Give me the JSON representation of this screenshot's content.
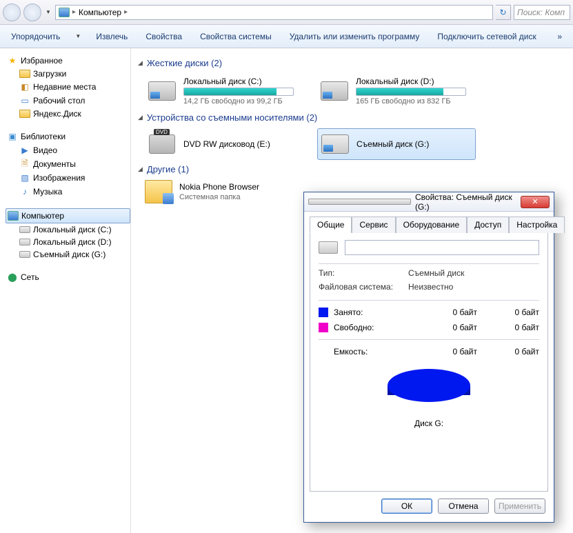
{
  "address": {
    "root": "Компьютер"
  },
  "search": {
    "placeholder": "Поиск: Комп"
  },
  "toolbar": {
    "organize": "Упорядочить",
    "eject": "Извлечь",
    "properties": "Свойства",
    "system_properties": "Свойства системы",
    "uninstall": "Удалить или изменить программу",
    "map_drive": "Подключить сетевой диск",
    "overflow": "»"
  },
  "sidebar": {
    "favorites": "Избранное",
    "fav_items": [
      "Загрузки",
      "Недавние места",
      "Рабочий стол",
      "Яндекс.Диск"
    ],
    "libraries": "Библиотеки",
    "lib_items": [
      "Видео",
      "Документы",
      "Изображения",
      "Музыка"
    ],
    "computer": "Компьютер",
    "comp_items": [
      "Локальный диск (C:)",
      "Локальный диск (D:)",
      "Съемный диск (G:)"
    ],
    "network": "Сеть"
  },
  "sections": {
    "hdd": "Жесткие диски (2)",
    "removable": "Устройства со съемными носителями (2)",
    "other": "Другие (1)"
  },
  "drives": {
    "c": {
      "name": "Локальный диск (C:)",
      "sub": "14,2 ГБ свободно из 99,2 ГБ",
      "fill_pct": 85
    },
    "d": {
      "name": "Локальный диск (D:)",
      "sub": "165 ГБ свободно из 832 ГБ",
      "fill_pct": 80
    },
    "dvd": {
      "name": "DVD RW дисковод (E:)"
    },
    "g": {
      "name": "Съемный диск (G:)"
    }
  },
  "other": {
    "nokia": {
      "name": "Nokia Phone Browser",
      "sub": "Системная папка"
    }
  },
  "dialog": {
    "title": "Свойства: Съемный диск (G:)",
    "tabs": [
      "Общие",
      "Сервис",
      "Оборудование",
      "Доступ",
      "Настройка"
    ],
    "type_label": "Тип:",
    "type_value": "Съемный диск",
    "fs_label": "Файловая система:",
    "fs_value": "Неизвестно",
    "used_label": "Занято:",
    "free_label": "Свободно:",
    "capacity_label": "Емкость:",
    "zero_bytes": "0 байт",
    "disk_caption": "Диск G:",
    "ok": "ОК",
    "cancel": "Отмена",
    "apply": "Применить"
  },
  "chart_data": {
    "type": "pie",
    "title": "Диск G:",
    "series": [
      {
        "name": "Занято",
        "value": 0,
        "unit": "байт",
        "color": "#0018f0"
      },
      {
        "name": "Свободно",
        "value": 0,
        "unit": "байт",
        "color": "#f000c8"
      }
    ],
    "capacity": {
      "value": 0,
      "unit": "байт"
    }
  }
}
